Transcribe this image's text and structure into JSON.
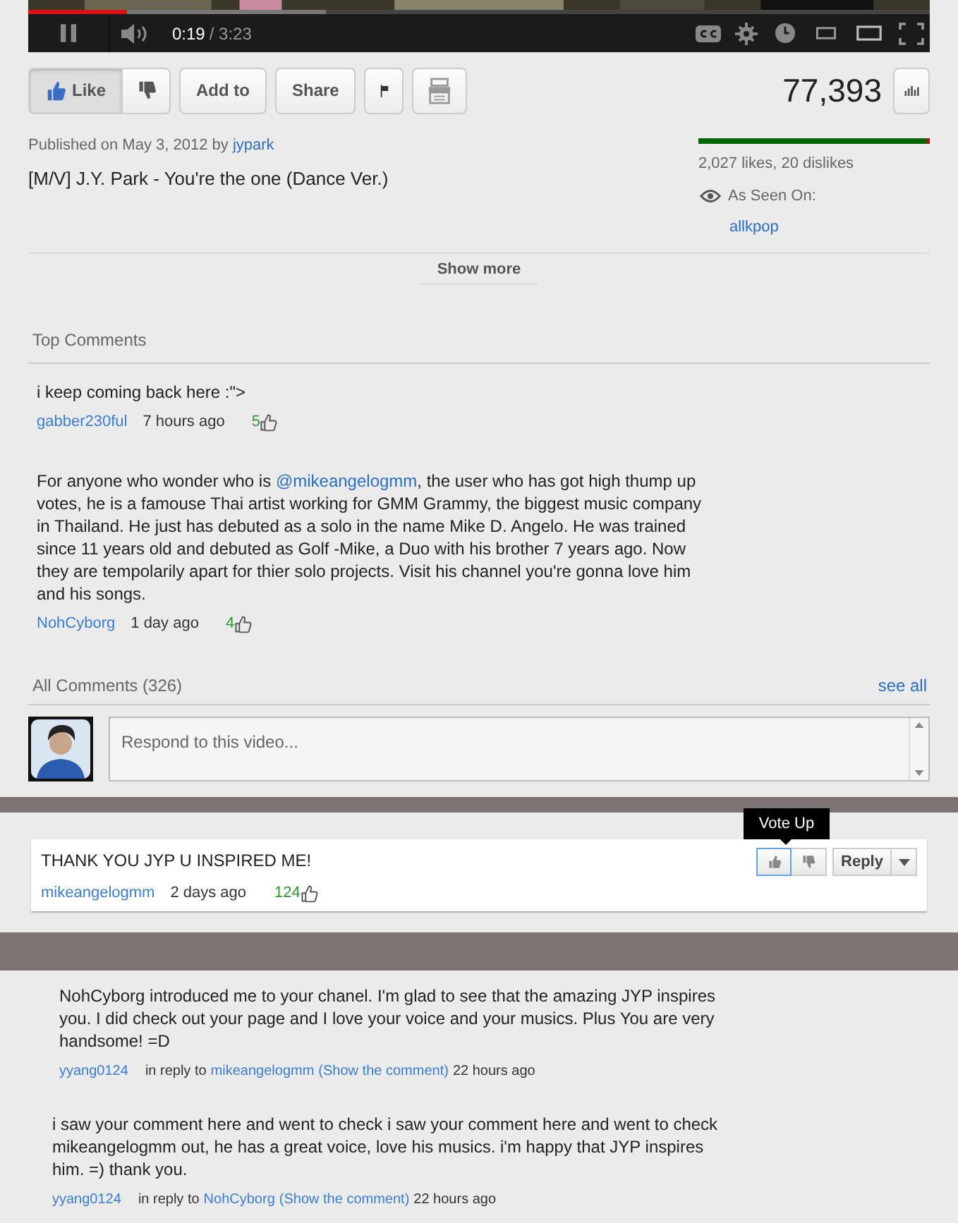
{
  "player": {
    "progress": {
      "level": 0.11
    },
    "buffer": {
      "level": 0.33
    },
    "time_current": "0:19",
    "time_total": "/ 3:23"
  },
  "actions": [
    {
      "kind": "like",
      "label": "Like",
      "selected": true
    },
    {
      "kind": "dislike",
      "selected": false
    },
    {
      "kind": "text",
      "label": "Add to",
      "selected": false
    },
    {
      "kind": "text",
      "label": "Share",
      "selected": false
    },
    {
      "kind": "flag",
      "selected": false
    },
    {
      "kind": "transcript",
      "selected": false
    }
  ],
  "view_count": "77,393",
  "published": {
    "text": "Published on May 3, 2012 by",
    "author": "jypark"
  },
  "video_title": "[M/V] J.Y. Park - You're the one (Dance Ver.)",
  "ratings": {
    "level": 0.99,
    "text": "2,027 likes, 20 dislikes"
  },
  "as_seen_on": {
    "label": "As Seen On:",
    "link": "allkpop"
  },
  "show_more": "Show more",
  "top_comments": {
    "title": "Top Comments",
    "comments": [
      {
        "parts": [
          {
            "text": "i keep coming back here :\">"
          }
        ],
        "author": "gabber230ful",
        "time": "7 hours ago",
        "votes": "5"
      },
      {
        "parts": [
          {
            "text": "For anyone who wonder who is "
          },
          {
            "mention": "@mikeangelogmm"
          },
          {
            "text": ", the user who has got high thump up votes, he is a famouse Thai artist working for GMM Grammy, the biggest music company in Thailand. He just has debuted as a solo in the name Mike D. Angelo. He was trained since 11 years old and debuted as Golf -Mike, a Duo with his brother 7 years ago. Now they are tempolarily apart for thier solo projects. Visit his channel you're gonna love him and his songs."
          }
        ],
        "author": "NohCyborg",
        "time": "1 day ago",
        "votes": "4"
      }
    ]
  },
  "all_comments": {
    "title": "All Comments (326)",
    "see_all": "see all",
    "respond": {
      "placeholder": "Respond to this video..."
    }
  },
  "highlighted_comment": {
    "text": "THANK YOU JYP U INSPIRED ME!",
    "author": "mikeangelogmm",
    "time": "2 days ago",
    "votes": "124",
    "tooltip": "Vote Up",
    "vote_up": {
      "selected": true
    },
    "vote_down": {
      "selected": false
    },
    "reply": "Reply"
  },
  "replies": [
    {
      "text": "NohCyborg introduced me to your chanel. I'm glad to see that the amazing JYP inspires you. I did check out your page and I love your voice and your musics. Plus You are very handsome! =D",
      "author": "yyang0124",
      "in_reply_to": "in reply to",
      "target": "mikeangelogmm",
      "show": "(Show the comment)",
      "time": "22 hours ago"
    },
    {
      "text": "i saw your comment here and went to check i saw your comment here and went to check mikeangelogmm out, he has a great voice, love his musics. i'm happy that JYP inspires him. =) thank you.",
      "author": "yyang0124",
      "in_reply_to": "in reply to",
      "target": "NohCyborg",
      "show": "(Show the comment)",
      "time": "22 hours ago"
    }
  ]
}
